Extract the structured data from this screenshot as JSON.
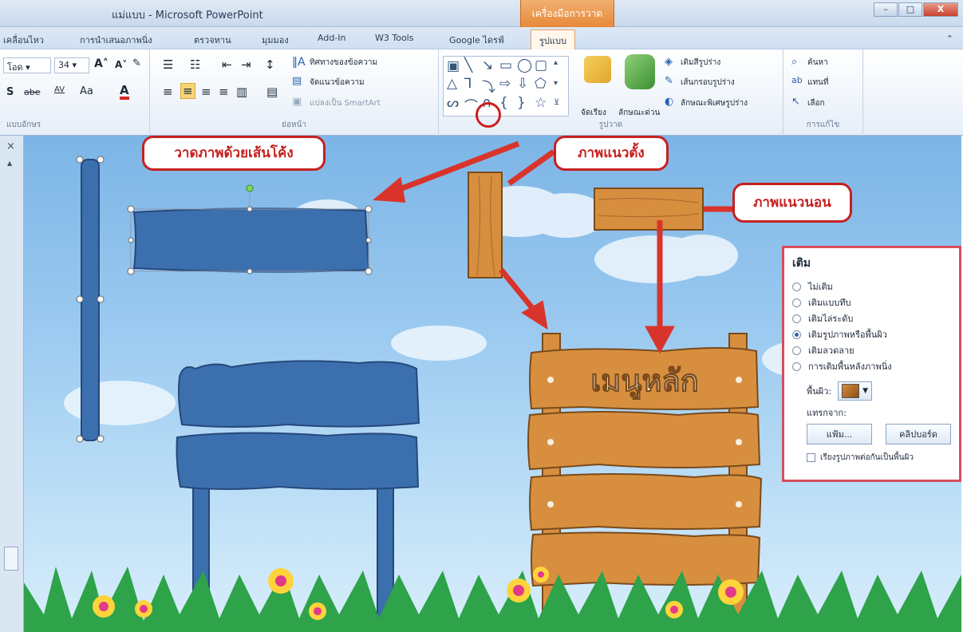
{
  "window": {
    "title": "แม่แบบ - Microsoft PowerPoint",
    "context_tab_title": "เครื่องมือการวาด",
    "minimize": "–",
    "maximize": "□",
    "close": "X"
  },
  "ribbon_tabs": [
    "เคลื่อนไหว",
    "การนำเสนอภาพนิ่ง",
    "ตรวจทาน",
    "มุมมอง",
    "Add-In",
    "W3 Tools",
    "Google ไดรฟ์",
    "รูปแบบ"
  ],
  "help_icon": "⌃",
  "font_group": {
    "font_name": "โอด",
    "font_size": "34",
    "grow_font": "A˄",
    "shrink_font": "A˅",
    "shadow": "S",
    "strike": "abe",
    "spacing": "AV",
    "change_case": "Aa",
    "font_color": "A",
    "label": "แบบอักษร"
  },
  "paragraph_group": {
    "text_direction": "ทิศทางของข้อความ",
    "align_text": "จัดแนวข้อความ",
    "convert_smartart": "แปลงเป็น SmartArt",
    "label": "ย่อหน้า"
  },
  "drawing_group": {
    "arrange": "จัดเรียง",
    "quick_styles": "ลักษณะด่วน",
    "shape_fill": "เติมสีรูปร่าง",
    "shape_outline": "เส้นกรอบรูปร่าง",
    "shape_effects": "ลักษณะพิเศษรูปร่าง",
    "label": "รูปวาด"
  },
  "editing_group": {
    "find": "ค้นหา",
    "replace": "แทนที่",
    "select": "เลือก",
    "label": "การแก้ไข"
  },
  "slide": {
    "callout_curve": "วาดภาพด้วยเส้นโค้ง",
    "callout_vertical": "ภาพแนวตั้ง",
    "callout_horizontal": "ภาพแนวนอน",
    "sign_text": "เมนูหลัก"
  },
  "fill_panel": {
    "title": "เติม",
    "options": [
      {
        "label": "ไม่เติม",
        "selected": false
      },
      {
        "label": "เติมแบบทึบ",
        "selected": false
      },
      {
        "label": "เติมไล่ระดับ",
        "selected": false
      },
      {
        "label": "เติมรูปภาพหรือพื้นผิว",
        "selected": true
      },
      {
        "label": "เติมลวดลาย",
        "selected": false
      },
      {
        "label": "การเติมพื้นหลังภาพนิ่ง",
        "selected": false
      }
    ],
    "texture_label": "พื้นผิว:",
    "insert_from": "แทรกจาก:",
    "file_button": "แฟ้ม...",
    "clipboard_button": "คลิปบอร์ด",
    "tile_checkbox": "เรียงรูปภาพต่อกันเป็นพื้นผิว"
  },
  "colors": {
    "sign_blue": "#3c6fae",
    "wood": "#d78f3f",
    "callout_red": "#c62020",
    "sky": "#9ccaf0"
  }
}
